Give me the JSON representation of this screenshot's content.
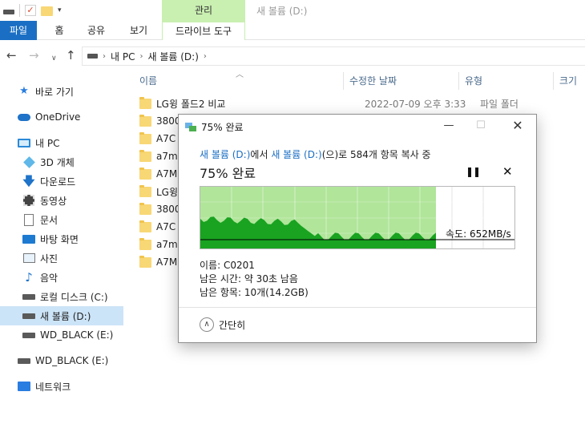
{
  "window": {
    "title": "새 볼륨 (D:)"
  },
  "ribbon": {
    "contextual_tab": "관리",
    "tabs": [
      "파일",
      "홈",
      "공유",
      "보기",
      "드라이브 도구"
    ]
  },
  "address": {
    "path": [
      "내 PC",
      "새 볼륨 (D:)"
    ]
  },
  "sidebar": {
    "items": [
      {
        "label": "바로 가기",
        "icon": "star-icon"
      },
      {
        "label": "OneDrive",
        "icon": "cloud-icon"
      },
      {
        "label": "내 PC",
        "icon": "computer-icon"
      },
      {
        "label": "3D 개체",
        "icon": "cube-icon"
      },
      {
        "label": "다운로드",
        "icon": "download-icon"
      },
      {
        "label": "동영상",
        "icon": "video-icon"
      },
      {
        "label": "문서",
        "icon": "document-icon"
      },
      {
        "label": "바탕 화면",
        "icon": "desktop-icon"
      },
      {
        "label": "사진",
        "icon": "pictures-icon"
      },
      {
        "label": "음악",
        "icon": "music-icon"
      },
      {
        "label": "로컬 디스크 (C:)",
        "icon": "drive-icon"
      },
      {
        "label": "새 볼륨 (D:)",
        "icon": "drive-icon"
      },
      {
        "label": "WD_BLACK (E:)",
        "icon": "drive-icon"
      },
      {
        "label": "WD_BLACK (E:)",
        "icon": "drive-icon"
      },
      {
        "label": "네트워크",
        "icon": "network-icon"
      }
    ]
  },
  "filelist": {
    "columns": [
      "이름",
      "수정한 날짜",
      "유형",
      "크기"
    ],
    "rows": [
      {
        "name": "LG윙 폴드2 비교",
        "date": "2022-07-09 오후 3:33",
        "type": "파일 폴더"
      },
      {
        "name": "3800"
      },
      {
        "name": "A7C"
      },
      {
        "name": "a7m"
      },
      {
        "name": "A7M"
      },
      {
        "name": "LG윙"
      },
      {
        "name": "3800"
      },
      {
        "name": "A7C"
      },
      {
        "name": "a7m"
      },
      {
        "name": "A7M"
      }
    ]
  },
  "copy_dialog": {
    "title": "75% 완료",
    "source": "새 볼륨 (D:)",
    "source_suffix": "에서 ",
    "dest": "새 볼륨 (D:)",
    "dest_suffix": "(으)로 584개 항목 복사 중",
    "percent_text": "75% 완료",
    "progress": 0.75,
    "speed": "속도: 652MB/s",
    "name_line": "이름: C0201",
    "time_line": "남은 시간: 약 30초 남음",
    "items_line": "남은 항목: 10개(14.2GB)",
    "collapse_label": "간단히",
    "colors": {
      "progress_fill": "#b0e59a",
      "throughput": "#19a320",
      "speed_line": "#000000"
    }
  }
}
